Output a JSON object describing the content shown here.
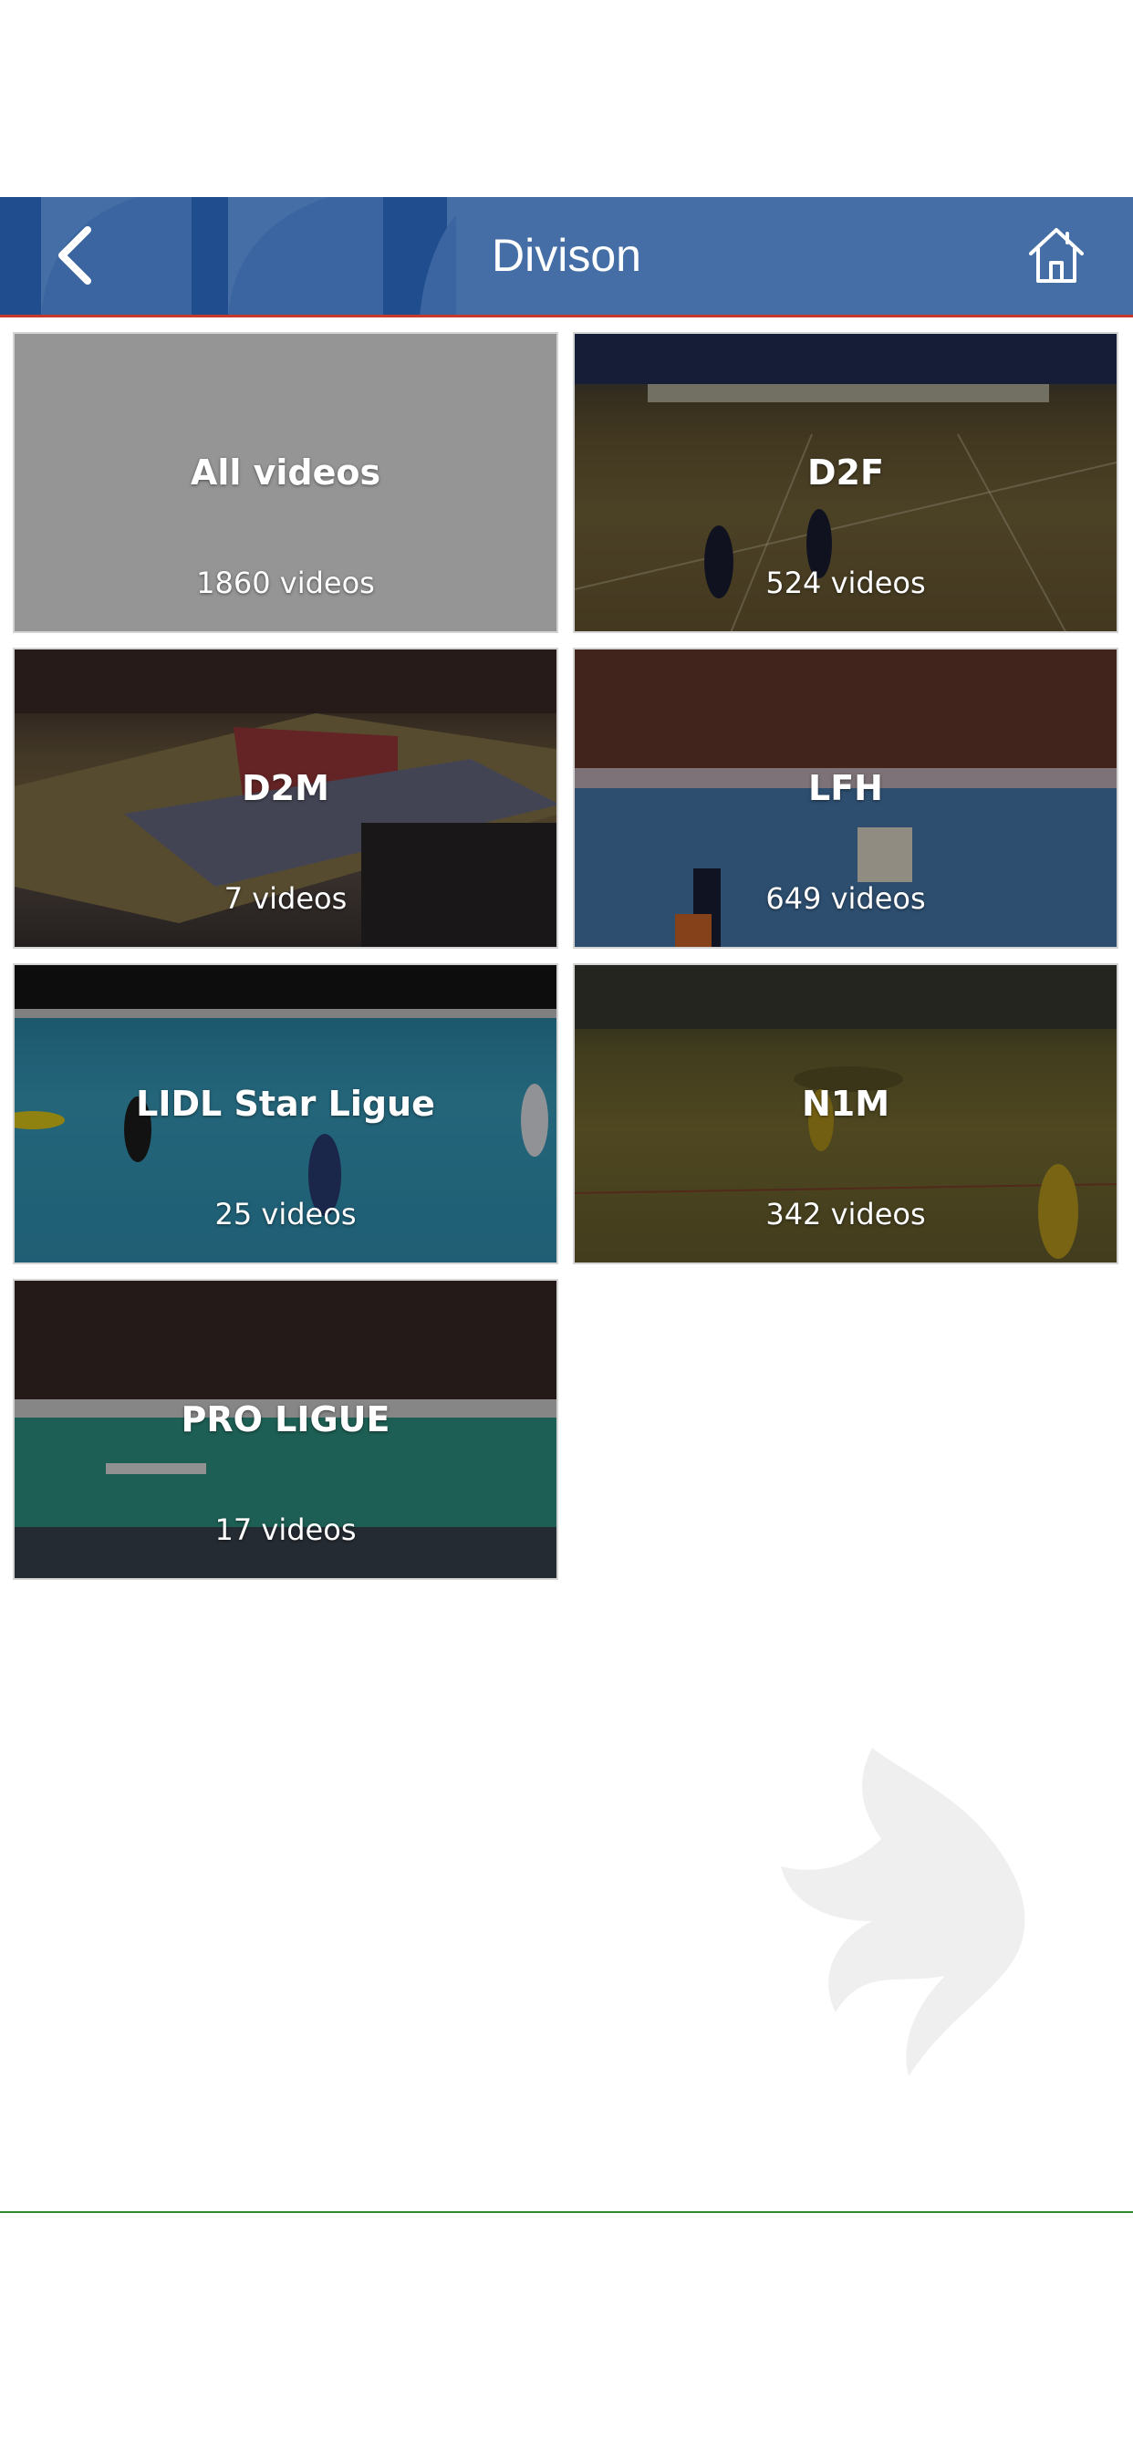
{
  "header": {
    "title": "Divison",
    "back_icon": "chevron-left-icon",
    "home_icon": "home-icon"
  },
  "tiles": [
    {
      "name": "All videos",
      "count": "1860 videos"
    },
    {
      "name": "D2F",
      "count": "524 videos"
    },
    {
      "name": "D2M",
      "count": "7 videos"
    },
    {
      "name": "LFH",
      "count": "649 videos"
    },
    {
      "name": "LIDL Star Ligue",
      "count": "25 videos"
    },
    {
      "name": "N1M",
      "count": "342 videos"
    },
    {
      "name": "PRO LIGUE",
      "count": "17 videos"
    }
  ],
  "colors": {
    "header_bg": "#446ea5",
    "header_border": "#c8392b",
    "footer_line": "#2f8a2a"
  }
}
